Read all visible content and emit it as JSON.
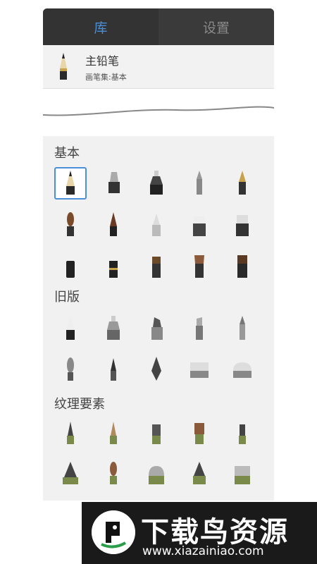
{
  "tabs": [
    {
      "label": "库",
      "active": true
    },
    {
      "label": "设置",
      "active": false
    }
  ],
  "current_brush": {
    "name": "主铅笔",
    "set": "画笔集:基本"
  },
  "sections": [
    {
      "title": "基本",
      "rows": 3
    },
    {
      "title": "旧版",
      "rows": 2
    },
    {
      "title": "纹理要素",
      "rows": 2
    }
  ],
  "banner": {
    "title": "下载鸟资源",
    "url": "www.xiazainiao.com"
  },
  "colors": {
    "accent": "#4a90d9",
    "tabbar": "#2f2f2f",
    "panel": "#f1f1f1"
  }
}
